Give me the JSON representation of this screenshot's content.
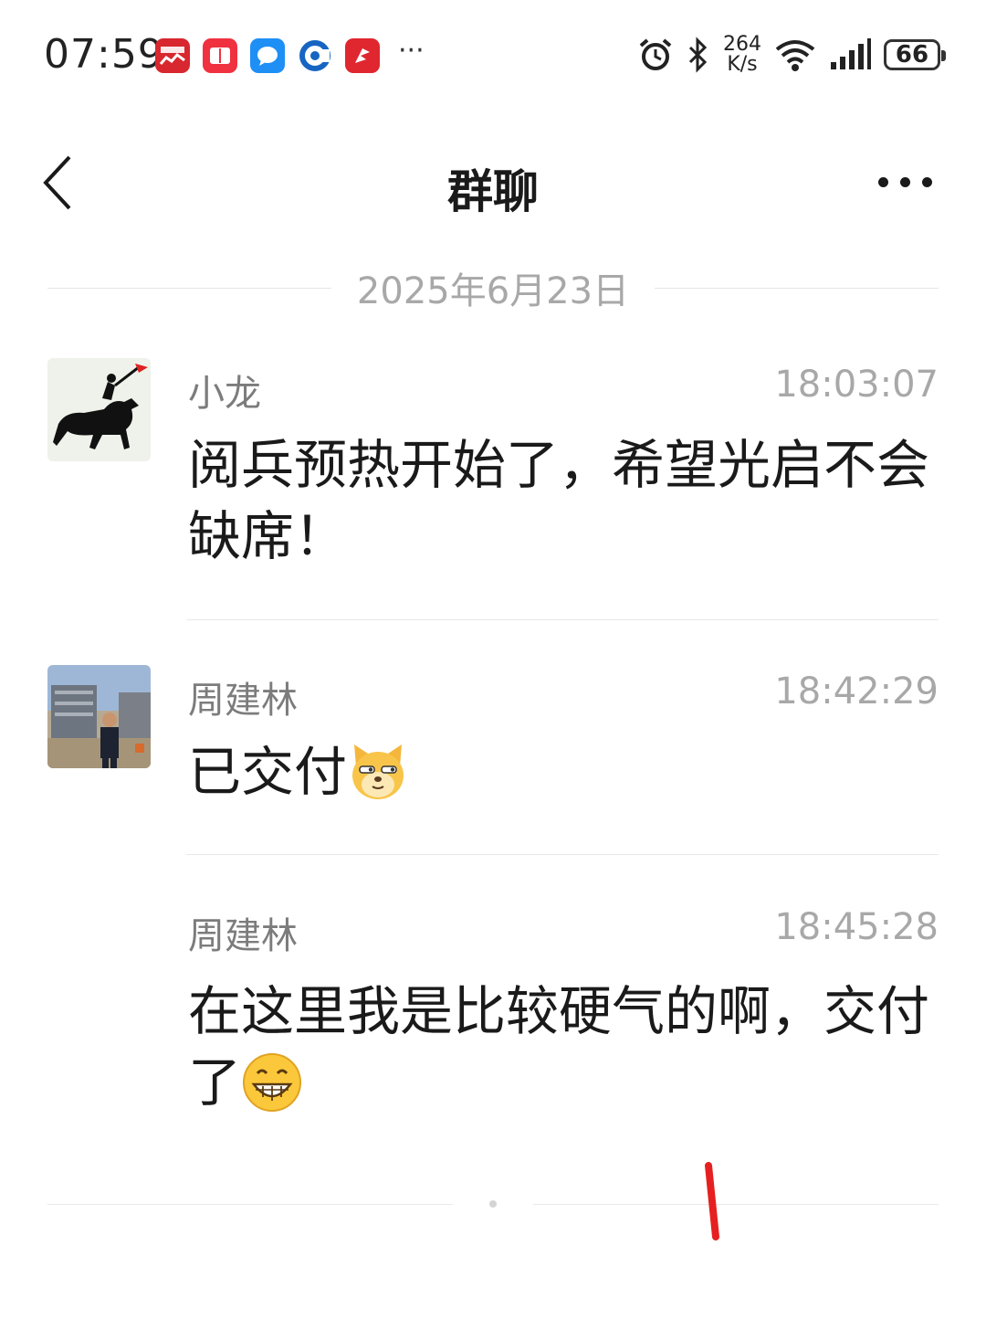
{
  "status_bar": {
    "time": "07:59",
    "app_icons": [
      "stock-app-icon",
      "red-book-icon",
      "blue-chat-icon",
      "bank-app-icon",
      "red-app-icon"
    ],
    "more": "···",
    "net_speed_value": "264",
    "net_speed_unit": "K/s",
    "battery": "66"
  },
  "header": {
    "title": "群聊"
  },
  "date_divider": "2025年6月23日",
  "messages": [
    {
      "sender": "小龙",
      "time": "18:03:07",
      "text": "阅兵预热开始了，希望光启不会缺席！"
    },
    {
      "sender": "周建林",
      "time": "18:42:29",
      "text": "已交付"
    },
    {
      "sender": "周建林",
      "time": "18:45:28",
      "text": "在这里我是比较硬气的啊，交付了"
    }
  ],
  "colors": {
    "accent_red": "#e62020",
    "text_primary": "#1a1a1a",
    "text_secondary": "#7c7c7c",
    "text_tertiary": "#a8a8a8"
  }
}
